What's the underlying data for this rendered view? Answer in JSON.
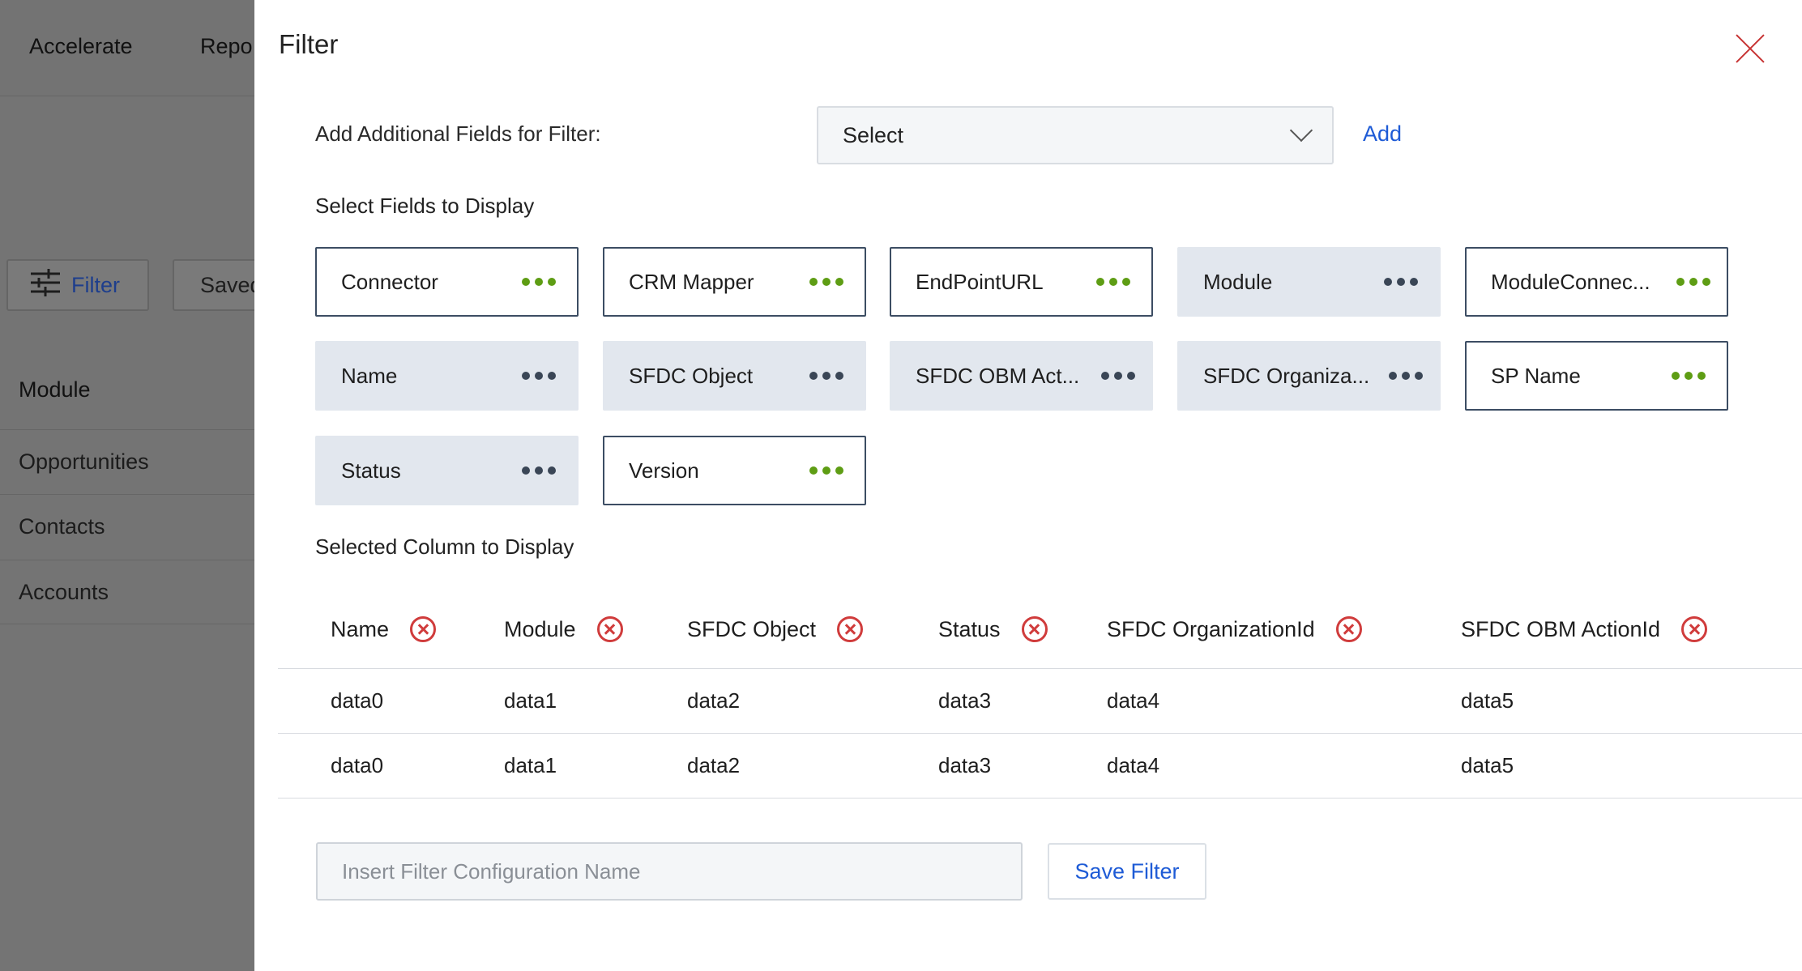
{
  "background_app": {
    "nav": [
      "Accelerate",
      "Repo"
    ],
    "filter_button": "Filter",
    "saved_button": "Saved",
    "section_title": "Module",
    "list": [
      "Opportunities",
      "Contacts",
      "Accounts"
    ]
  },
  "modal": {
    "title": "Filter",
    "add_fields_label": "Add Additional Fields for Filter:",
    "select_value": "Select",
    "add_label": "Add",
    "fields_heading": "Select Fields to Display",
    "fields": [
      {
        "label": "Connector",
        "state": "selected"
      },
      {
        "label": "CRM Mapper",
        "state": "selected"
      },
      {
        "label": "EndPointURL",
        "state": "selected"
      },
      {
        "label": "Module",
        "state": "unselected"
      },
      {
        "label": "ModuleConnec...",
        "state": "selected"
      },
      {
        "label": "Name",
        "state": "unselected"
      },
      {
        "label": "SFDC Object",
        "state": "unselected"
      },
      {
        "label": "SFDC OBM Act...",
        "state": "unselected"
      },
      {
        "label": "SFDC Organiza...",
        "state": "unselected"
      },
      {
        "label": "SP Name",
        "state": "selected"
      },
      {
        "label": "Status",
        "state": "unselected"
      },
      {
        "label": "Version",
        "state": "selected"
      }
    ],
    "columns_heading": "Selected Column to Display",
    "columns": [
      "Name",
      "Module",
      "SFDC Object",
      "Status",
      "SFDC OrganizationId",
      "SFDC OBM ActionId"
    ],
    "rows": [
      [
        "data0",
        "data1",
        "data2",
        "data3",
        "data4",
        "data5"
      ],
      [
        "data0",
        "data1",
        "data2",
        "data3",
        "data4",
        "data5"
      ]
    ],
    "config_name_placeholder": "Insert Filter Configuration Name",
    "save_label": "Save Filter"
  },
  "colors": {
    "accent_blue": "#1e5bd6",
    "active_dots": "#5e9d14",
    "inactive_dots": "#3a4656",
    "remove_red": "#d03c3c",
    "chip_inactive_bg": "#e2e7ee"
  },
  "icons": [
    "sliders-icon",
    "close-icon",
    "chevron-down-icon",
    "more-dots-icon",
    "remove-circle-icon"
  ]
}
